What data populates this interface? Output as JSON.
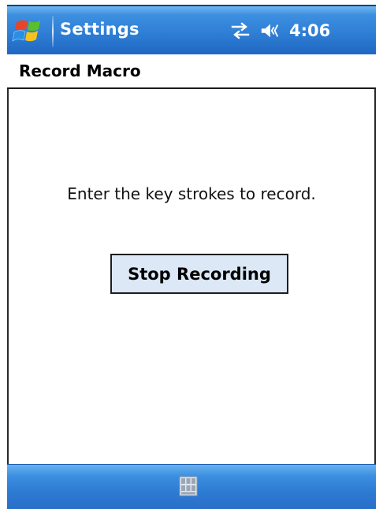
{
  "titlebar": {
    "app_title": "Settings",
    "time": "4:06",
    "icons": [
      "windows-start-icon",
      "connectivity-icon",
      "volume-icon"
    ]
  },
  "header": {
    "title": "Record Macro"
  },
  "main": {
    "instruction": "Enter the key strokes to record.",
    "stop_button_label": "Stop Recording"
  },
  "menubar": {
    "icons": [
      "keyboard-input-icon"
    ]
  },
  "colors": {
    "titlebar_blue": "#2f7fd6",
    "button_fill": "#dce8f6",
    "border_dark": "#1e1e1e"
  }
}
